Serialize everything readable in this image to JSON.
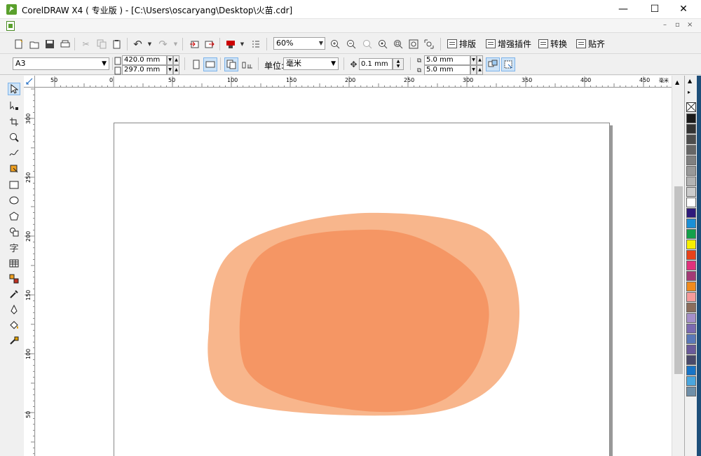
{
  "window": {
    "title": "CorelDRAW X4 ( 专业版 ) - [C:\\Users\\oscaryang\\Desktop\\火苗.cdr]",
    "minimize_glyph": "—",
    "maximize_glyph": "☐",
    "close_glyph": "✕"
  },
  "mdi": {
    "minimize_glyph": "–",
    "restore_glyph": "▫",
    "close_glyph": "×"
  },
  "toolbar": {
    "zoom_value": "60%",
    "text_buttons": [
      "排版",
      "增强插件",
      "转换",
      "贴齐"
    ]
  },
  "property_bar": {
    "paper_size": "A3",
    "width": "420.0 mm",
    "height": "297.0 mm",
    "units_label": "单位:",
    "units_value": "毫米",
    "nudge": "0.1 mm",
    "dup_x": "5.0 mm",
    "dup_y": "5.0 mm"
  },
  "ruler": {
    "h_labels": [
      "50",
      "0",
      "50",
      "100",
      "150",
      "200",
      "250",
      "300",
      "350",
      "400",
      "450"
    ],
    "h_unit": "毫米",
    "v_labels": [
      "300",
      "250",
      "200",
      "150",
      "100",
      "50"
    ]
  },
  "tools": [
    "pick-tool",
    "shape-tool",
    "crop-tool",
    "zoom-tool",
    "freehand-tool",
    "smart-fill-tool",
    "rectangle-tool",
    "ellipse-tool",
    "polygon-tool",
    "basic-shapes-tool",
    "text-tool",
    "table-tool",
    "interactive-blend-tool",
    "eyedropper-tool",
    "outline-tool",
    "fill-tool",
    "interactive-fill-tool"
  ],
  "text_tool_glyph": "字",
  "shapes": {
    "outer_color": "#f8b68c",
    "inner_color": "#f59664"
  },
  "palette": [
    "#1a1a1a",
    "#333333",
    "#4d4d4d",
    "#666666",
    "#808080",
    "#999999",
    "#b3b3b3",
    "#cccccc",
    "#ffffff",
    "#2e1a7a",
    "#1b8fd6",
    "#12a04a",
    "#f7f000",
    "#e8421a",
    "#e0327c",
    "#a33a76",
    "#f08b1d",
    "#f49b9b",
    "#8b6d5c",
    "#a58fc9",
    "#7c6ab0",
    "#5a78b8",
    "#6a5a9a",
    "#4a4a6a",
    "#1874c6",
    "#4aa6de",
    "#6f8fa8"
  ]
}
